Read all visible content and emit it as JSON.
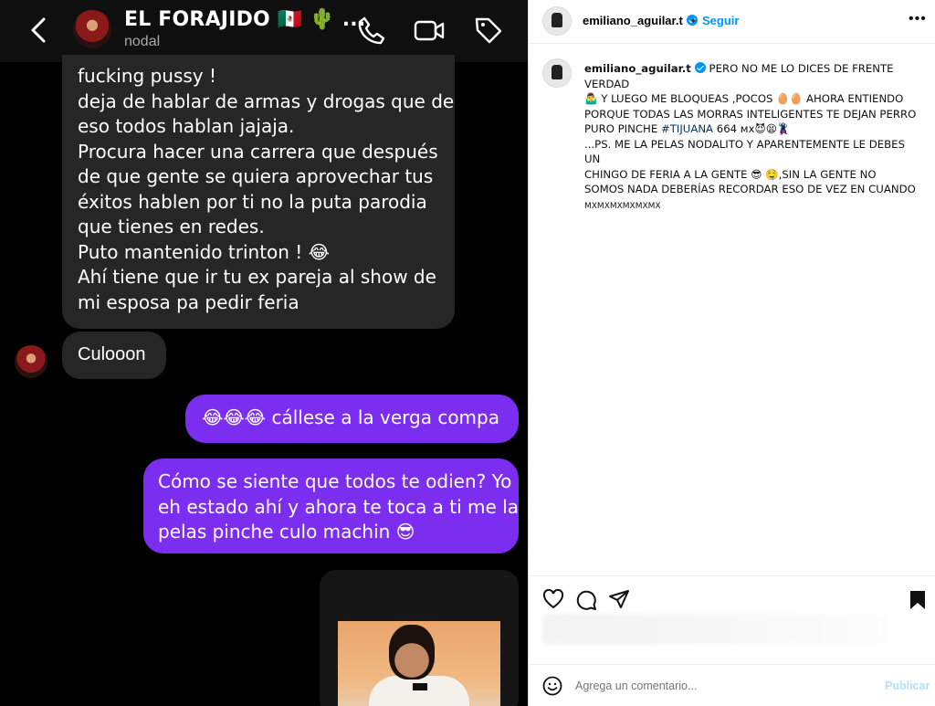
{
  "chat": {
    "name": "EL FORAJIDO 🇲🇽 🌵 ...",
    "subtitle": "nodal",
    "messages_in_1": [
      "fucking pussy !",
      "deja de hablar de armas y drogas que de",
      "eso todos hablan jajaja.",
      "Procura hacer una carrera que después",
      "de que gente se quiera aprovechar tus",
      "éxitos hablen por ti no la puta parodia",
      "que tienes en redes.",
      "Puto mantenido trinton ! 😂",
      "Ahí tiene que ir tu ex pareja al show de",
      "mi esposa pa pedir feria"
    ],
    "message_in_2": "Culooon",
    "message_out_1": "😂😂😂 cállese a la verga compa",
    "message_out_2": [
      "Cómo se siente que todos te odien? Yo",
      "eh estado ahí y ahora te toca a ti me la",
      "pelas pinche culo machin 😎"
    ],
    "icons": [
      "chevron-left",
      "phone",
      "video-camera",
      "tag"
    ]
  },
  "instagram": {
    "username": "emiliano_aguilar.t",
    "separator": "•",
    "follow_label": "Seguir",
    "more": "•••",
    "caption": {
      "line1": "PERO NO ME LO DICES DE FRENTE VERDAD",
      "line2": "🤷‍♂️ Y LUEGO ME BLOQUEAS ,POCOS 🥚🥚 AHORA ENTIENDO",
      "line3": "PORQUE TODAS LAS MORRAS INTELIGENTES TE DEJAN PERRO",
      "line4_a": "PURO PINCHE",
      "hashtag": "#TIJUANA",
      "line4_b": "664 мх😈😫🦹",
      "line5": "...PS. ME LA PELAS NODALITO Y APARENTEMENTE LE DEBES UN",
      "line6": "CHINGO DE FERIA A LA GENTE 😎 🤤,SIN LA GENTE NO",
      "line7": "SOMOS NADA DEBERÍAS RECORDAR ESO DE VEZ EN CUANDO",
      "line8": "MXMXMXMXMXMX"
    },
    "comment_placeholder": "Agrega un comentario...",
    "publish_label": "Publicar",
    "accent_color": "#0095f6"
  }
}
